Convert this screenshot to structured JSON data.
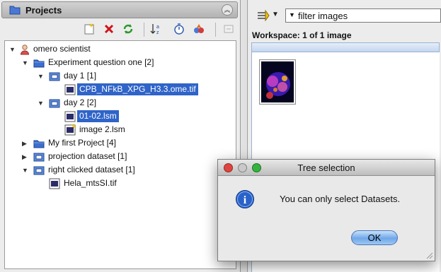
{
  "projects_panel": {
    "title": "Projects"
  },
  "tree": {
    "root": "omero scientist",
    "experiment": "Experiment question one [2]",
    "day1": "day 1 [1]",
    "day1_image": "CPB_NFkB_XPG_H3.3.ome.tif",
    "day2": "day 2 [2]",
    "day2_image_a": "01-02.lsm",
    "day2_image_b": "image 2.lsm",
    "my_first_project": "My first Project [4]",
    "projection_dataset": "projection dataset  [1]",
    "right_clicked_dataset": "right clicked dataset [1]",
    "hela_image": "Hela_mtsSI.tif"
  },
  "workspace": {
    "filter": "filter  images",
    "title": "Workspace: 1 of 1 image"
  },
  "dialog": {
    "title": "Tree selection",
    "message": "You can only select Datasets.",
    "ok_label": "OK"
  },
  "colors": {
    "selection": "#2f64c8",
    "folder": "#3b6fd1",
    "ok_button": "#6fa7e8"
  }
}
